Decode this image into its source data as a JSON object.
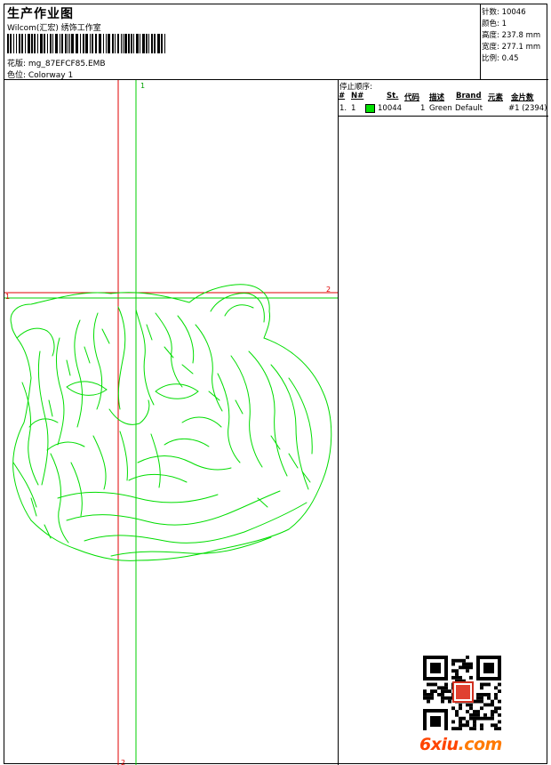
{
  "header": {
    "title": "生产作业图",
    "company": "Wilcom(汇宏) 绣饰工作室",
    "design_label": "花版: mg_87EFCF85.EMB",
    "colorway_label": "色位:  Colorway 1"
  },
  "specs": {
    "stitches": "针数:  10046",
    "colors": "颜色:  1",
    "height": "高度:  237.8 mm",
    "width": "宽度:  277.1 mm",
    "scale": "比例:  0.45"
  },
  "stop_sequence": {
    "title": "停止顺序:",
    "columns": [
      "#",
      "N#",
      "St.",
      "代码",
      "描述",
      "Brand",
      "元素",
      "金片数"
    ],
    "rows": [
      {
        "index": "1.",
        "needle": "1",
        "stitches": "10044",
        "code": "1",
        "description": "Green",
        "brand": "Default",
        "element": "#1 (2394)",
        "swatch_color": "#00e000"
      }
    ]
  },
  "guides": {
    "label_top": "1",
    "label_left": "1",
    "label_right": "2",
    "label_bottom": "2",
    "red": "#e00000",
    "green": "#00d000"
  },
  "watermark": {
    "logo_main": "6xiu",
    "logo_dot": ".com",
    "logo_color": "#ff4400"
  }
}
